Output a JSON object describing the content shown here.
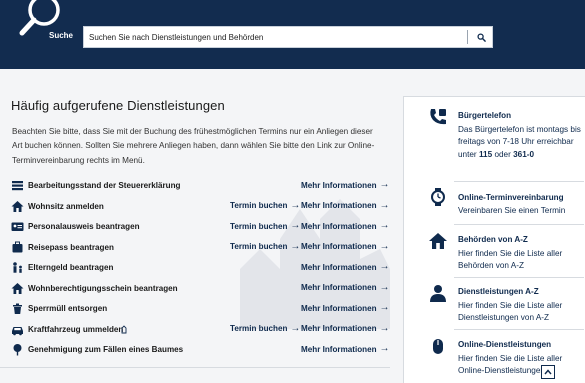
{
  "header": {
    "search_caption": "Suche",
    "search_placeholder": "Suchen Sie nach Dienstleistungen und Behörden",
    "bg_color": "#122c4f"
  },
  "main": {
    "title": "Häufig aufgerufene Dienstleistungen",
    "intro": "Beachten Sie bitte, dass Sie mit der Buchung des frühestmöglichen Termins nur ein Anliegen dieser Art buchen können. Sollten Sie mehrere Anliegen haben, dann wählen Sie bitte den Link zur Online-Terminvereinbarung rechts im Menü.",
    "services": [
      {
        "label": "Bearbeitungsstand der Steuererklärung",
        "icon": "stack-icon",
        "termin": "",
        "mehr": "Mehr Informationen"
      },
      {
        "label": "Wohnsitz anmelden",
        "icon": "house-icon",
        "termin": "Termin buchen",
        "mehr": "Mehr Informationen"
      },
      {
        "label": "Personalausweis beantragen",
        "icon": "id-card-icon",
        "termin": "Termin buchen",
        "mehr": "Mehr Informationen"
      },
      {
        "label": "Reisepass beantragen",
        "icon": "passport-icon",
        "termin": "Termin buchen",
        "mehr": "Mehr Informationen"
      },
      {
        "label": "Elterngeld beantragen",
        "icon": "family-icon",
        "termin": "",
        "mehr": "Mehr Informationen"
      },
      {
        "label": "Wohnberechtigungsschein beantragen",
        "icon": "house-icon",
        "termin": "",
        "mehr": "Mehr Informationen"
      },
      {
        "label": "Sperrmüll entsorgen",
        "icon": "bulky-waste-icon",
        "termin": "",
        "mehr": "Mehr Informationen"
      },
      {
        "label": "Kraftfahrzeug ummelden",
        "icon": "car-icon",
        "termin": "Termin buchen",
        "mehr": "Mehr Informationen"
      },
      {
        "label": "Genehmigung zum Fällen eines Baumes",
        "icon": "tree-icon",
        "termin": "",
        "mehr": "Mehr Informationen"
      }
    ]
  },
  "sidebar": {
    "buergertelefon": {
      "title": "Bürgertelefon",
      "text_pre": "Das Bürgertelefon ist montags bis freitags von 7-18 Uhr erreichbar unter",
      "number1": "115",
      "text_mid": "oder",
      "number2": "361-0"
    },
    "online_termin": {
      "title": "Online-Terminvereinbarung",
      "text": "Vereinbaren Sie einen Termin"
    },
    "behoerden": {
      "title": "Behörden von A-Z",
      "text": "Hier finden Sie die Liste aller Behörden von A-Z"
    },
    "dienstleistungen_az": {
      "title": "Dienstleistungen A-Z",
      "text": "Hier finden Sie die Liste aller Dienstleistungen von A-Z"
    },
    "online_dienste": {
      "title": "Online-Dienstleistungen",
      "text": "Hier finden Sie die Liste aller Online-Dienstleistungen"
    }
  },
  "colors": {
    "navy": "#0f2a4d",
    "background": "#f4f5f7"
  }
}
